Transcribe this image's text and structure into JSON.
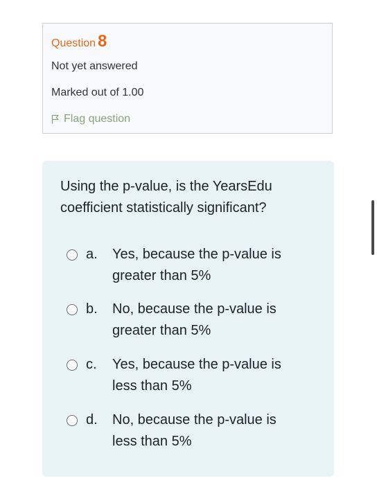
{
  "question_info": {
    "label": "Question",
    "number": "8",
    "state": "Not yet answered",
    "grade": "Marked out of 1.00",
    "flag_label": "Flag question"
  },
  "question": {
    "text": "Using the p-value, is the YearsEdu coefficient statistically significant?",
    "options": [
      {
        "letter": "a.",
        "text": "Yes, because the p-value is greater than 5%"
      },
      {
        "letter": "b.",
        "text": "No, because the p-value is greater than 5%"
      },
      {
        "letter": "c.",
        "text": "Yes, because the p-value is less than 5%"
      },
      {
        "letter": "d.",
        "text": "No, because the p-value is less than 5%"
      }
    ]
  },
  "icons": {
    "flag": "flag-icon",
    "radio": "radio-unchecked"
  },
  "colors": {
    "question_label": "#e06a1b",
    "flag_link": "#8aa37e",
    "info_bg": "#f8f9fa",
    "question_bg": "#e7f3f5"
  }
}
